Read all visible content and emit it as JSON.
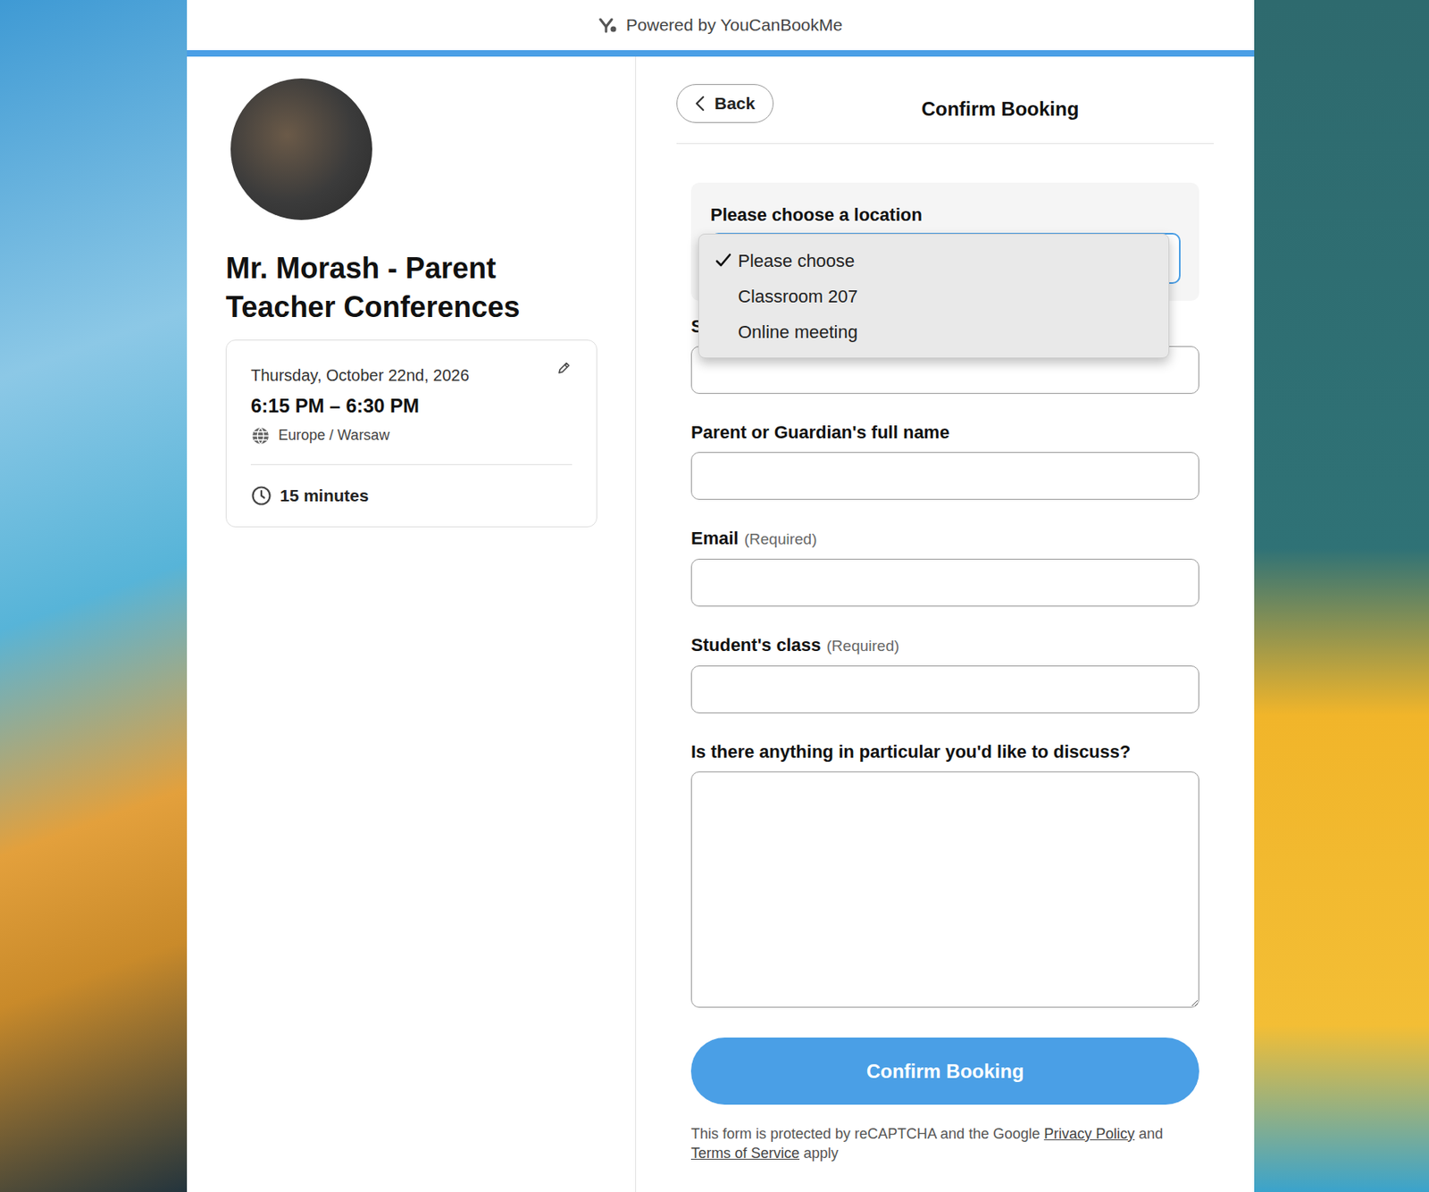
{
  "header": {
    "powered_by": "Powered by YouCanBookMe"
  },
  "profile": {
    "title": "Mr. Morash - Parent Teacher Conferences"
  },
  "booking": {
    "date": "Thursday, October 22nd, 2026",
    "time": "6:15 PM – 6:30 PM",
    "timezone": "Europe / Warsaw",
    "duration": "15 minutes"
  },
  "nav": {
    "back": "Back",
    "title": "Confirm Booking"
  },
  "location": {
    "label": "Please choose a location",
    "expanded": true,
    "options": [
      {
        "label": "Please choose",
        "selected": true
      },
      {
        "label": "Classroom 207",
        "selected": false
      },
      {
        "label": "Online meeting",
        "selected": false
      }
    ]
  },
  "fields": [
    {
      "label": "S",
      "hint": "",
      "kind": "input"
    },
    {
      "label": "Parent or Guardian's full name",
      "hint": "",
      "kind": "input"
    },
    {
      "label": "Email",
      "hint": "(Required)",
      "kind": "input"
    },
    {
      "label": "Student's class",
      "hint": "(Required)",
      "kind": "input"
    },
    {
      "label": "Is there anything in particular you'd like to discuss?",
      "hint": "",
      "kind": "textarea"
    }
  ],
  "submit": "Confirm Booking",
  "footer": {
    "before": "This form is protected by reCAPTCHA and the Google ",
    "privacy": "Privacy Policy",
    "middle": " and ",
    "terms": "Terms of Service",
    "after": " apply"
  }
}
